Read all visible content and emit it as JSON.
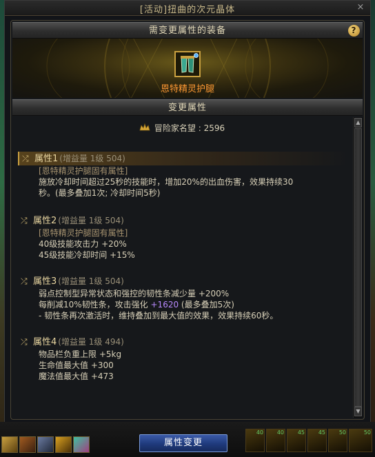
{
  "window": {
    "title": "[活动]扭曲的次元晶体",
    "close_label": "×"
  },
  "equipment_section": {
    "header": "需变更属性的装备",
    "help_label": "?",
    "item_name": "恩特精灵护腿",
    "item_color": "#ff9933"
  },
  "attributes_section": {
    "header": "变更属性",
    "fame_label": "冒险家名望 : 2596"
  },
  "attributes": [
    {
      "name": "属性1",
      "meta": "(增益量 1级 504)",
      "selected": true,
      "inherent": "[恩特精灵护腿固有属性]",
      "lines": [
        "施放冷却时间超过25秒的技能时，增加20%的出血伤害，效果持续30",
        "秒。(最多叠加1次; 冷却时间5秒)"
      ]
    },
    {
      "name": "属性2",
      "meta": "(增益量 1级 504)",
      "selected": false,
      "inherent": "[恩特精灵护腿固有属性]",
      "lines": [
        "40级技能攻击力 +20%",
        "45级技能冷却时间 +15%"
      ]
    },
    {
      "name": "属性3",
      "meta": "(增益量 1级 504)",
      "selected": false,
      "lines": [
        "弱点控制型异常状态和强控的韧性条减少量 +200%"
      ],
      "line_with_value": {
        "before": "每削减10%韧性条，攻击强化 ",
        "value": "+1620",
        "after": " (最多叠加5次)"
      },
      "lines_after": [
        "- 韧性条再次激活时，维持叠加到最大值的效果，效果持续60秒。"
      ]
    },
    {
      "name": "属性4",
      "meta": "(增益量 1级 494)",
      "selected": false,
      "lines": [
        "物品栏负重上限 +5kg",
        "生命值最大值 +300",
        "魔法值最大值 +473"
      ]
    }
  ],
  "actions": {
    "change_button": "属性变更"
  },
  "hotbar": {
    "skill_counts": [
      "40",
      "40",
      "45",
      "45",
      "50",
      "50"
    ]
  },
  "icons": {
    "shuffle": "shuffle-icon",
    "fame": "fame-crown-icon"
  }
}
